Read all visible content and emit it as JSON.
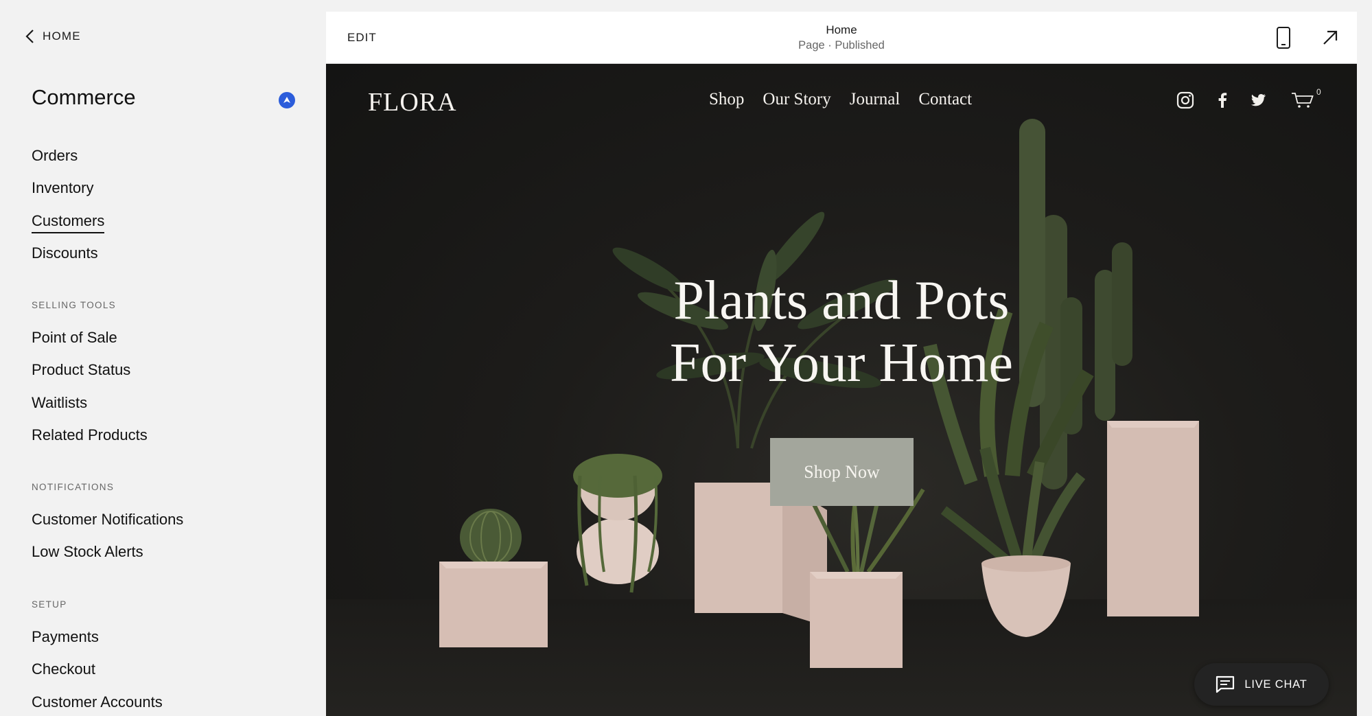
{
  "sidebar": {
    "back_label": "HOME",
    "section_title": "Commerce",
    "main_items": [
      {
        "label": "Orders"
      },
      {
        "label": "Inventory"
      },
      {
        "label": "Customers"
      },
      {
        "label": "Discounts"
      }
    ],
    "active_item": "Customers",
    "groups": [
      {
        "heading": "SELLING TOOLS",
        "items": [
          {
            "label": "Point of Sale"
          },
          {
            "label": "Product Status"
          },
          {
            "label": "Waitlists"
          },
          {
            "label": "Related Products"
          }
        ]
      },
      {
        "heading": "NOTIFICATIONS",
        "items": [
          {
            "label": "Customer Notifications"
          },
          {
            "label": "Low Stock Alerts"
          }
        ]
      },
      {
        "heading": "SETUP",
        "items": [
          {
            "label": "Payments"
          },
          {
            "label": "Checkout"
          },
          {
            "label": "Customer Accounts"
          }
        ]
      }
    ]
  },
  "preview_bar": {
    "edit_label": "EDIT",
    "page_name": "Home",
    "page_status": "Page · Published",
    "icons": [
      "mobile-view-icon",
      "open-external-icon"
    ]
  },
  "website": {
    "logo": "FLORA",
    "nav": [
      {
        "label": "Shop"
      },
      {
        "label": "Our Story"
      },
      {
        "label": "Journal"
      },
      {
        "label": "Contact"
      }
    ],
    "social_icons": [
      "instagram-icon",
      "facebook-icon",
      "twitter-icon",
      "cart-icon"
    ],
    "cart_count": "0",
    "hero_title_line1": "Plants and Pots",
    "hero_title_line2": "For Your Home",
    "cta_label": "Shop Now"
  },
  "live_chat": {
    "label": "LIVE CHAT"
  },
  "colors": {
    "accent_badge": "#2c5ddb",
    "hero_bg": "#1a1a1a",
    "cta_bg": "#a3a69c",
    "pot": "#d8c0b6"
  }
}
